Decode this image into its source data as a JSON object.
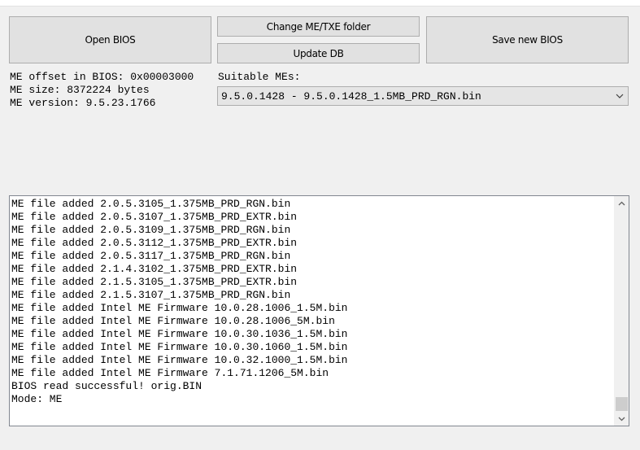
{
  "buttons": {
    "open_bios": "Open BIOS",
    "change_folder": "Change ME/TXE folder",
    "update_db": "Update DB",
    "save_bios": "Save new BIOS"
  },
  "info": {
    "me_offset": "ME offset in BIOS: 0x00003000",
    "me_size": "ME size: 8372224 bytes",
    "me_version": "ME version: 9.5.23.1766"
  },
  "suitable": {
    "label": "Suitable MEs:",
    "selected": "9.5.0.1428 - 9.5.0.1428_1.5MB_PRD_RGN.bin"
  },
  "log": {
    "lines": [
      "ME file added 2.0.5.3105_1.375MB_PRD_RGN.bin",
      "ME file added 2.0.5.3107_1.375MB_PRD_EXTR.bin",
      "ME file added 2.0.5.3109_1.375MB_PRD_RGN.bin",
      "ME file added 2.0.5.3112_1.375MB_PRD_EXTR.bin",
      "ME file added 2.0.5.3117_1.375MB_PRD_RGN.bin",
      "ME file added 2.1.4.3102_1.375MB_PRD_EXTR.bin",
      "ME file added 2.1.5.3105_1.375MB_PRD_EXTR.bin",
      "ME file added 2.1.5.3107_1.375MB_PRD_RGN.bin",
      "ME file added Intel ME Firmware 10.0.28.1006_1.5M.bin",
      "ME file added Intel ME Firmware 10.0.28.1006_5M.bin",
      "ME file added Intel ME Firmware 10.0.30.1036_1.5M.bin",
      "ME file added Intel ME Firmware 10.0.30.1060_1.5M.bin",
      "ME file added Intel ME Firmware 10.0.32.1000_1.5M.bin",
      "ME file added Intel ME Firmware 7.1.71.1206_5M.bin",
      "BIOS read successful! orig.BIN",
      "Mode: ME"
    ]
  },
  "icons": {
    "combo_arrow": "chevron-down-icon",
    "scroll_up": "chevron-up-icon",
    "scroll_down": "chevron-down-icon"
  },
  "colors": {
    "window_bg": "#f0f0f0",
    "button_bg": "#e1e1e1",
    "button_border": "#adadad",
    "log_bg": "#ffffff",
    "scroll_thumb": "#cdcdcd"
  }
}
